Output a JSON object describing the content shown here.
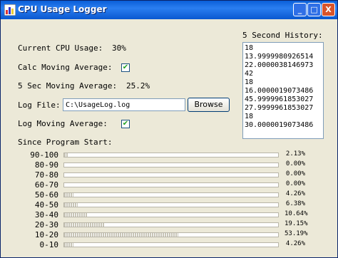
{
  "window": {
    "title": "CPU Usage Logger",
    "controls": {
      "minimize": "_",
      "maximize": "□",
      "close": "X"
    }
  },
  "main": {
    "current_cpu_label": "Current CPU Usage:",
    "current_cpu_value": "30%",
    "calc_moving_avg_label": "Calc Moving Average:",
    "calc_moving_avg_checked": true,
    "moving_avg_label": "5 Sec Moving Average:",
    "moving_avg_value": "25.2%",
    "log_file_label": "Log File:",
    "log_file_value": "C:\\UsageLog.log",
    "browse_label": "Browse",
    "log_moving_avg_label": "Log Moving Average:",
    "log_moving_avg_checked": true,
    "since_start_label": "Since Program Start:"
  },
  "history": {
    "label": "5 Second History:",
    "items": [
      "18",
      "13.9999980926514",
      "22.0000038146973",
      "42",
      "18",
      "16.0000019073486",
      "45.9999961853027",
      "27.9999961853027",
      "18",
      "30.0000019073486"
    ]
  },
  "histogram": [
    {
      "range": "90-100",
      "percent": "2.13%",
      "fraction": 0.0213
    },
    {
      "range": "80-90",
      "percent": "0.00%",
      "fraction": 0
    },
    {
      "range": "70-80",
      "percent": "0.00%",
      "fraction": 0
    },
    {
      "range": "60-70",
      "percent": "0.00%",
      "fraction": 0
    },
    {
      "range": "50-60",
      "percent": "4.26%",
      "fraction": 0.0426
    },
    {
      "range": "40-50",
      "percent": "6.38%",
      "fraction": 0.0638
    },
    {
      "range": "30-40",
      "percent": "10.64%",
      "fraction": 0.1064
    },
    {
      "range": "20-30",
      "percent": "19.15%",
      "fraction": 0.1915
    },
    {
      "range": "10-20",
      "percent": "53.19%",
      "fraction": 0.5319
    },
    {
      "range": "0-10",
      "percent": "4.26%",
      "fraction": 0.0426
    }
  ],
  "colors": {
    "titlebar": "#0a5fd8",
    "window_bg": "#ece9d8",
    "close_button": "#d9542b",
    "check": "#21a121"
  }
}
